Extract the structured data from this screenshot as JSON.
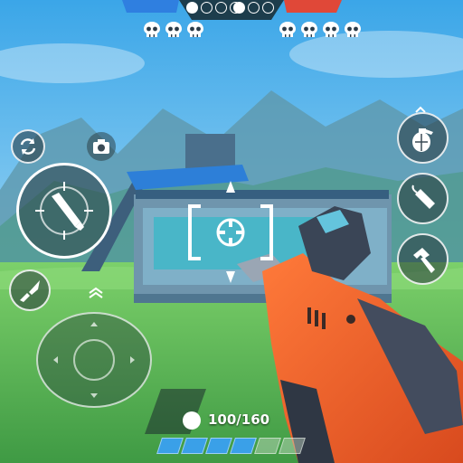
{
  "scoreboard": {
    "blue_team_dots": [
      "filled",
      "empty",
      "empty",
      "empty"
    ],
    "red_team_dots": [
      "filled",
      "empty",
      "empty"
    ],
    "blue_skull_count": 3,
    "red_skull_count": 4,
    "colors": {
      "blue": "#2f7fe0",
      "red": "#e04838",
      "panel": "#1d3d4c"
    }
  },
  "controls": {
    "left": [
      "reload-icon",
      "camera-icon",
      "fire-bullet-icon",
      "knife-icon",
      "movement-joystick"
    ],
    "right": [
      "grenade-icon",
      "dynamite-icon",
      "hammer-icon"
    ]
  },
  "ammo": {
    "text": "100/160",
    "current": 100,
    "max": 160,
    "bar_segments_total": 6,
    "bar_segments_filled": 4
  },
  "weapon": {
    "color": "#e85a2a",
    "name_icon": "blaster-rifle"
  }
}
